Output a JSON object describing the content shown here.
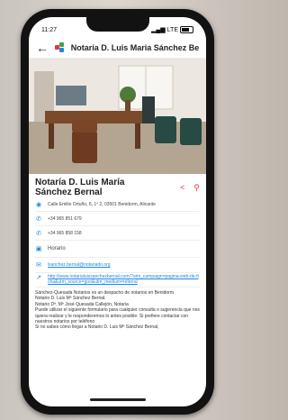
{
  "status": {
    "time": "11:27",
    "carrier": "LTE"
  },
  "header": {
    "title": "Notaría D. Luis Maria Sánchez Bernal"
  },
  "place": {
    "name": "Notaría D. Luis María Sánchez Bernal",
    "address": "Calle Emilio Ortuño, 6, 1º 2, 03501 Benidorm, Alicante",
    "phone1": "+34 965 851 679",
    "phone2": "+34 965 858 158",
    "hours_label": "Horario",
    "email": "lsanchez.bernal@notariado.org",
    "website": "http://www.notarialuissanchezbernal.com/?utm_campaign=pagina-web-de-ficha&utm_source=goo&utm_medium=referral"
  },
  "description": [
    "Sánchez-Quesada Notarios es un despacho de notarios en Benidorm.",
    "Notario D. Luis Mª Sánchez Bernal.",
    "Notario Dª. Mª José Quesada Callejón, Notaria",
    "Puede utilizar el siguiente formulario para cualquier consulta o sugerencia que nos quiera realizar y le responderemos lo antes posible. Si prefiere contactar con nuestros notarios por teléfono",
    "Si no sabes cómo llegar a Notario D. Luis Mª Sánchez Bernal,"
  ],
  "colors": {
    "accent": "#1e88e5",
    "action": "#e53935"
  }
}
